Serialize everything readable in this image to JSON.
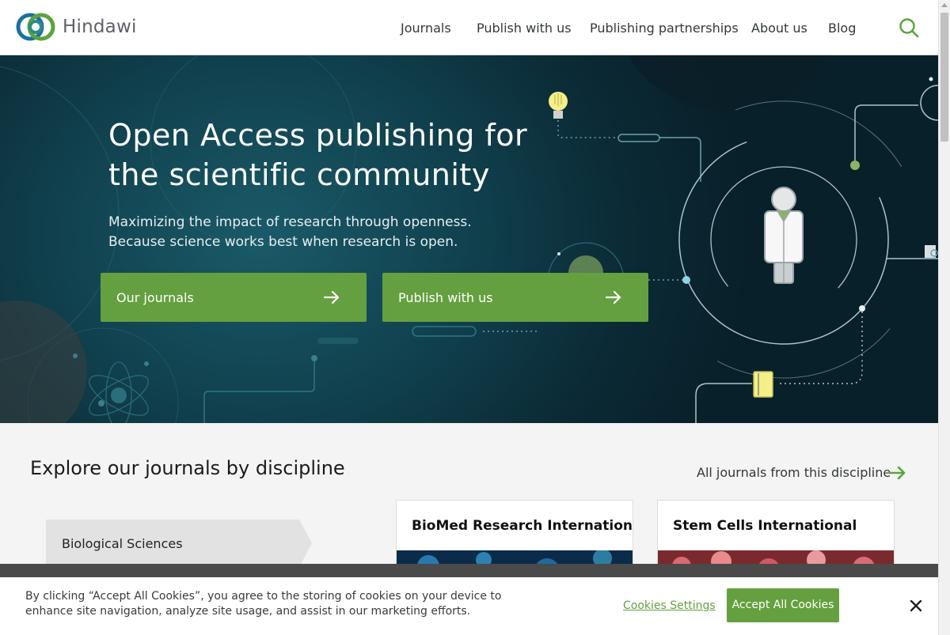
{
  "brand": {
    "name": "Hindawi",
    "accent": "#64a03f",
    "logo_blue": "#1d6fa5",
    "logo_green": "#5ba33b"
  },
  "nav": {
    "items": [
      {
        "label": "Journals"
      },
      {
        "label": "Publish with us"
      },
      {
        "label": "Publishing partnerships"
      },
      {
        "label": "About us"
      },
      {
        "label": "Blog"
      }
    ],
    "search_icon": "search-icon"
  },
  "hero": {
    "title": "Open Access publishing for the scientific community",
    "subtitle": "Maximizing the impact of research through openness. Because science works best when research is open.",
    "buttons": [
      {
        "label": "Our journals",
        "icon": "arrow-right-icon"
      },
      {
        "label": "Publish with us",
        "icon": "arrow-right-icon"
      }
    ]
  },
  "explore": {
    "title": "Explore our journals by discipline",
    "all_link": "All journals from this discipline",
    "selected_discipline": "Biological Sciences",
    "journals": [
      {
        "title": "BioMed Research International"
      },
      {
        "title": "Stem Cells International"
      }
    ]
  },
  "cookie": {
    "text": "By clicking “Accept All Cookies”, you agree to the storing of cookies on your device to enhance site navigation, analyze site usage, and assist in our marketing efforts.",
    "settings_label": "Cookies Settings",
    "accept_label": "Accept All Cookies",
    "close_icon": "close-icon"
  }
}
